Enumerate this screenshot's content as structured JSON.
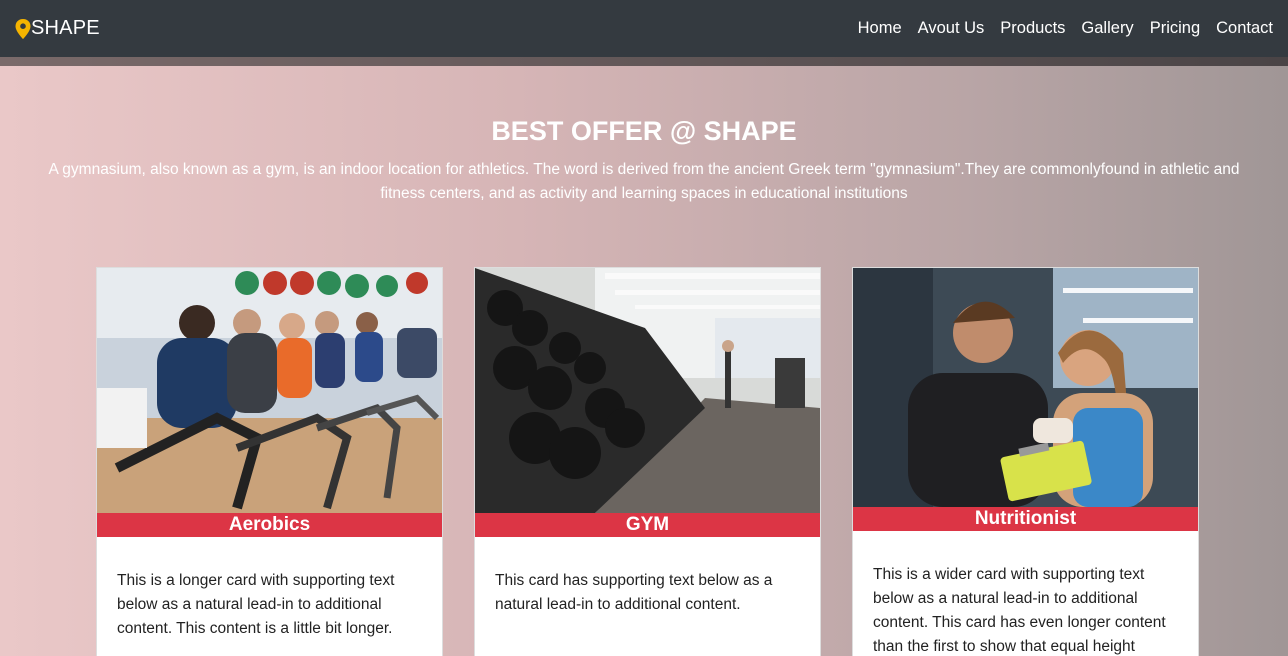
{
  "navbar": {
    "brand": "SHAPE",
    "links": [
      "Home",
      "Avout Us",
      "Products",
      "Gallery",
      "Pricing",
      "Contact"
    ]
  },
  "hero": {
    "title": "BEST OFFER @ SHAPE",
    "description": "A gymnasium, also known as a gym, is an indoor location for athletics. The word is derived from the ancient Greek term \"gymnasium\".They are commonlyfound in athletic and fitness centers, and as activity and learning spaces in educational institutions"
  },
  "cards": [
    {
      "title": "Aerobics",
      "text": "This is a longer card with supporting text below as a natural lead-in to additional content. This content is a little bit longer."
    },
    {
      "title": "GYM",
      "text": "This card has supporting text below as a natural lead-in to additional content."
    },
    {
      "title": "Nutritionist",
      "text": "This is a wider card with supporting text below as a natural lead-in to additional content. This card has even longer content than the first to show that equal height"
    }
  ],
  "colors": {
    "navbar": "#343a40",
    "accent": "#dc3545",
    "pin": "#f5b400"
  },
  "icons": {
    "brand": "map-pin-icon"
  }
}
